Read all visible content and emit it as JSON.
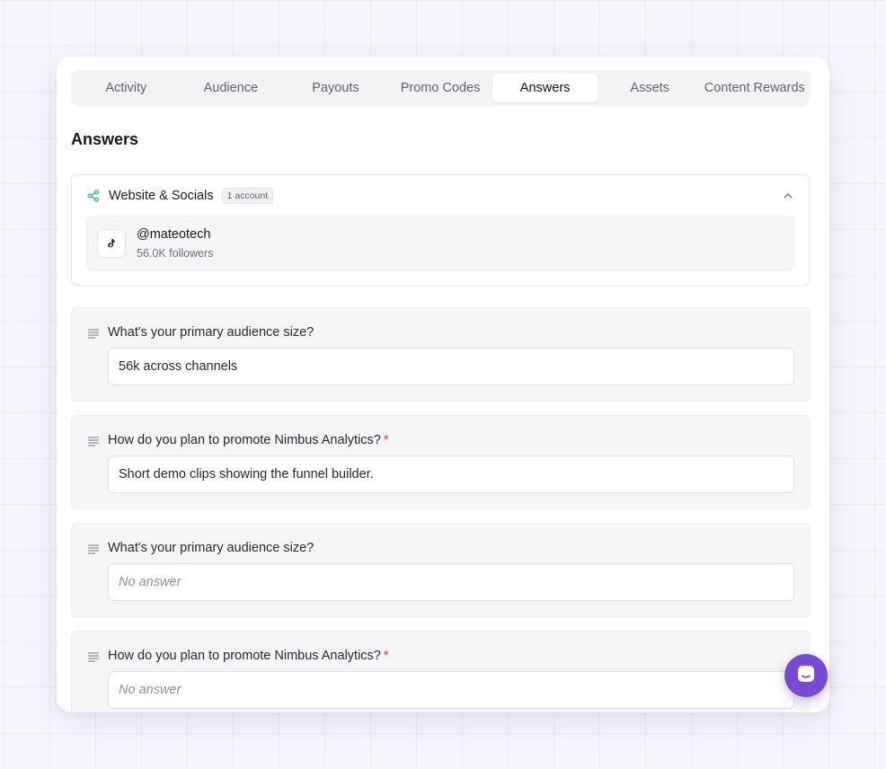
{
  "tabs": [
    {
      "label": "Activity"
    },
    {
      "label": "Audience"
    },
    {
      "label": "Payouts"
    },
    {
      "label": "Promo Codes"
    },
    {
      "label": "Answers",
      "active": true
    },
    {
      "label": "Assets"
    },
    {
      "label": "Content Rewards"
    }
  ],
  "page_title": "Answers",
  "socials": {
    "title": "Website & Socials",
    "badge": "1 account",
    "account": {
      "platform_icon": "tiktok-icon",
      "handle": "@mateotech",
      "followers": "56.0K followers"
    }
  },
  "questions": [
    {
      "label": "What's your primary audience size?",
      "required": false,
      "answer": "56k across channels"
    },
    {
      "label": "How do you plan to promote Nimbus Analytics?",
      "required": true,
      "answer": "Short demo clips showing the funnel builder."
    },
    {
      "label": "What's your primary audience size?",
      "required": false,
      "answer": "No answer"
    },
    {
      "label": "How do you plan to promote Nimbus Analytics?",
      "required": true,
      "answer": "No answer"
    }
  ],
  "required_marker": "*",
  "colors": {
    "accent": "#7749d6",
    "share_icon": "#2bb3a8",
    "required": "#e03a3a"
  }
}
